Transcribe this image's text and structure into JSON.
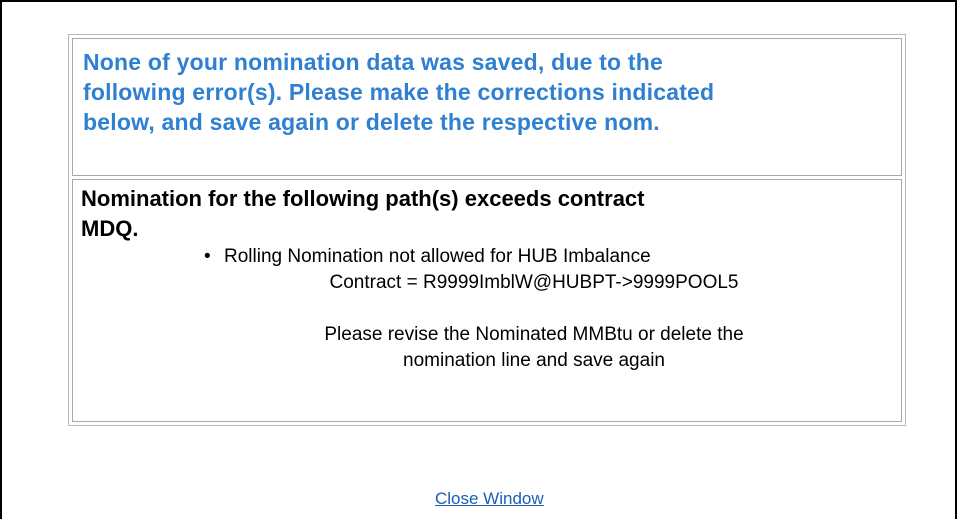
{
  "header": {
    "message_line1": "None of your nomination data was saved, due to the",
    "message_line2": "following error(s). Please make the corrections indicated",
    "message_line3": "below, and save again or delete the respective nom."
  },
  "error": {
    "title_line1": "Nomination for the following path(s) exceeds contract",
    "title_line2": "MDQ.",
    "bullet": "•",
    "item_line1": "Rolling Nomination not allowed for HUB Imbalance",
    "item_line2": "Contract = R9999ImblW@HUBPT->9999POOL5",
    "instruction_line1": "Please revise the Nominated MMBtu or delete the",
    "instruction_line2": "nomination line and save again"
  },
  "footer": {
    "close_label": "Close Window"
  }
}
